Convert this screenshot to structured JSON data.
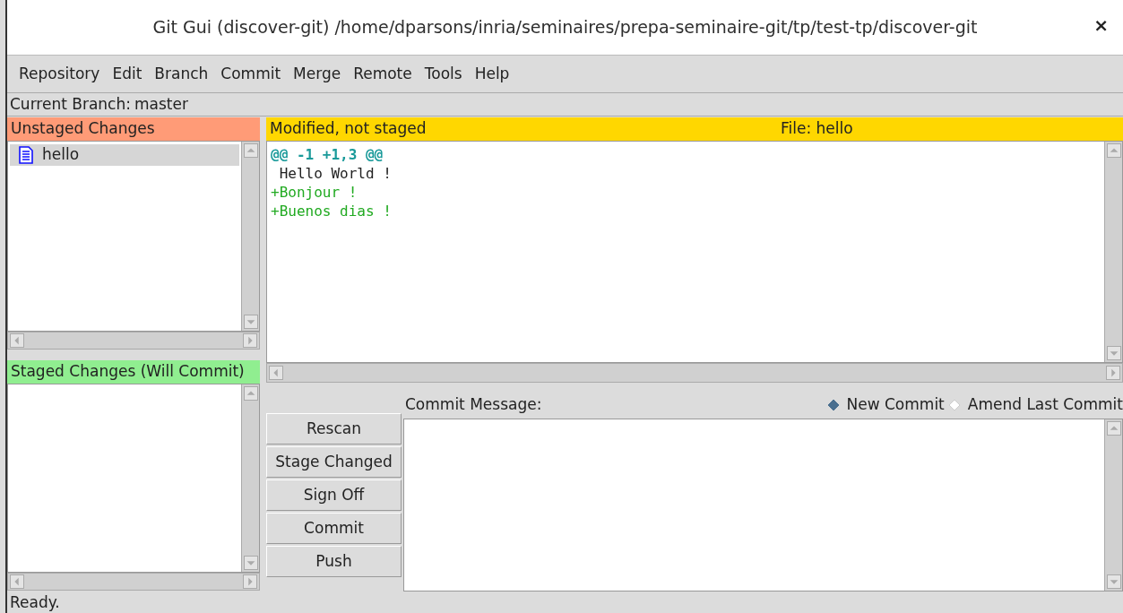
{
  "window": {
    "title": "Git Gui (discover-git) /home/dparsons/inria/seminaires/prepa-seminaire-git/tp/test-tp/discover-git",
    "close": "×"
  },
  "menu": [
    "Repository",
    "Edit",
    "Branch",
    "Commit",
    "Merge",
    "Remote",
    "Tools",
    "Help"
  ],
  "branch": {
    "label": "Current Branch:",
    "value": "master"
  },
  "unstaged": {
    "title": "Unstaged Changes",
    "files": [
      {
        "name": "hello",
        "selected": true
      }
    ]
  },
  "staged": {
    "title": "Staged Changes (Will Commit)"
  },
  "diff": {
    "status": "Modified, not staged",
    "file": "File: hello",
    "lines": [
      {
        "kind": "hunk",
        "text": "@@ -1 +1,3 @@"
      },
      {
        "kind": "context",
        "text": " Hello World !"
      },
      {
        "kind": "added",
        "text": "+Bonjour !"
      },
      {
        "kind": "added",
        "text": "+Buenos dias !"
      }
    ]
  },
  "commit": {
    "label": "Commit Message:",
    "modes": [
      {
        "label": "New Commit",
        "selected": true
      },
      {
        "label": "Amend Last Commit",
        "selected": false
      }
    ],
    "buttons": [
      "Rescan",
      "Stage Changed",
      "Sign Off",
      "Commit",
      "Push"
    ]
  },
  "status_bar": "Ready."
}
